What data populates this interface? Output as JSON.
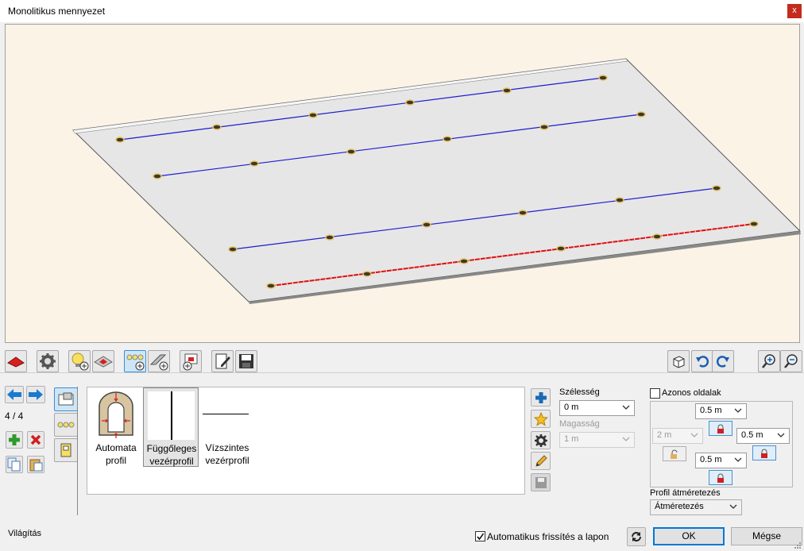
{
  "window": {
    "title": "Monolitikus mennyezet",
    "close": "x"
  },
  "nav": {
    "page_indicator": "4 / 4"
  },
  "profiles": [
    {
      "line1": "Automata",
      "line2": "profil"
    },
    {
      "line1": "Függőleges",
      "line2": "vezérprofil"
    },
    {
      "line1": "Vízszintes",
      "line2": "vezérprofil"
    }
  ],
  "props": {
    "width_label": "Szélesség",
    "width_value": "0 m",
    "height_label": "Magasság",
    "height_value": "1 m"
  },
  "sides": {
    "same_sides_label": "Azonos oldalak",
    "top_value": "0.5 m",
    "left_value": "2 m",
    "right_value": "0.5 m",
    "bottom_value": "0.5 m"
  },
  "resize": {
    "label": "Profil átméretezés",
    "value": "Átméretezés"
  },
  "footer": {
    "status": "Világítás",
    "auto_refresh": "Automatikus frissítés a lapon",
    "ok": "OK",
    "cancel": "Mégse"
  },
  "colors": {
    "accent": "#0078d7",
    "line_blue": "#1c1cd0",
    "line_red": "#e01010",
    "viewport_bg": "#fbf3e6"
  }
}
